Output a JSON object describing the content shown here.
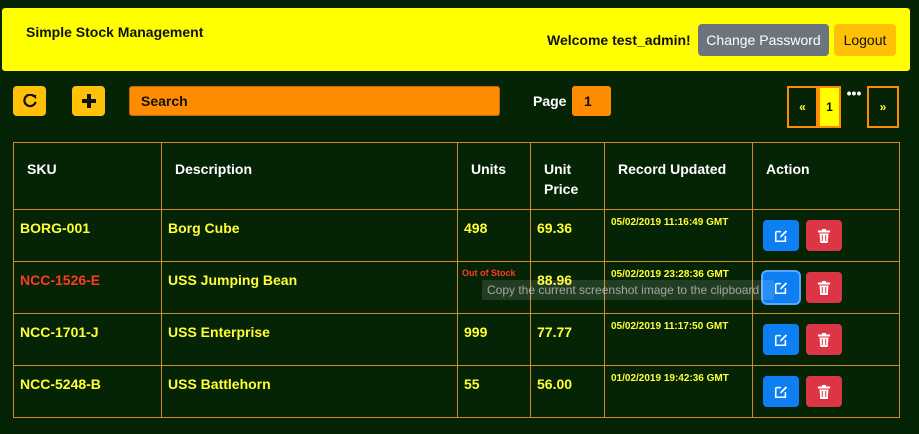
{
  "header": {
    "brand": "Simple Stock Management",
    "welcome": "Welcome test_admin!",
    "change_password": "Change Password",
    "logout": "Logout"
  },
  "toolbar": {
    "refresh_icon": "refresh-icon",
    "add_icon": "plus-icon",
    "search_placeholder": "Search",
    "page_label": "Page",
    "page_value": "1"
  },
  "pagination": {
    "prev": "«",
    "current": "1",
    "dots": "•••",
    "next": "»"
  },
  "table": {
    "headers": {
      "sku": "SKU",
      "description": "Description",
      "units": "Units",
      "unit_price_line1": "Unit",
      "unit_price_line2": "Price",
      "record_updated": "Record Updated",
      "action": "Action"
    },
    "rows": [
      {
        "sku": "BORG-001",
        "description": "Borg Cube",
        "units": "498",
        "price": "69.36",
        "updated": "05/02/2019 11:16:49 GMT"
      },
      {
        "sku": "NCC-1526-E",
        "description": "USS Jumping Bean",
        "units": "Out of Stock",
        "price": "88.96",
        "updated": "05/02/2019 23:28:36 GMT"
      },
      {
        "sku": "NCC-1701-J",
        "description": "USS Enterprise",
        "units": "999",
        "price": "77.77",
        "updated": "05/02/2019 11:17:50 GMT"
      },
      {
        "sku": "NCC-5248-B",
        "description": "USS Battlehorn",
        "units": "55",
        "price": "56.00",
        "updated": "01/02/2019 19:42:36 GMT"
      }
    ]
  },
  "tooltip": "Copy the current screenshot image to the clipboard",
  "colors": {
    "background": "#052305",
    "header": "#ffff00",
    "accent_orange": "#ff8c00",
    "accent_yellow": "#ffc107",
    "edit_blue": "#0d7ff2",
    "delete_red": "#dc3545",
    "out_of_stock": "#ff3b1f"
  }
}
